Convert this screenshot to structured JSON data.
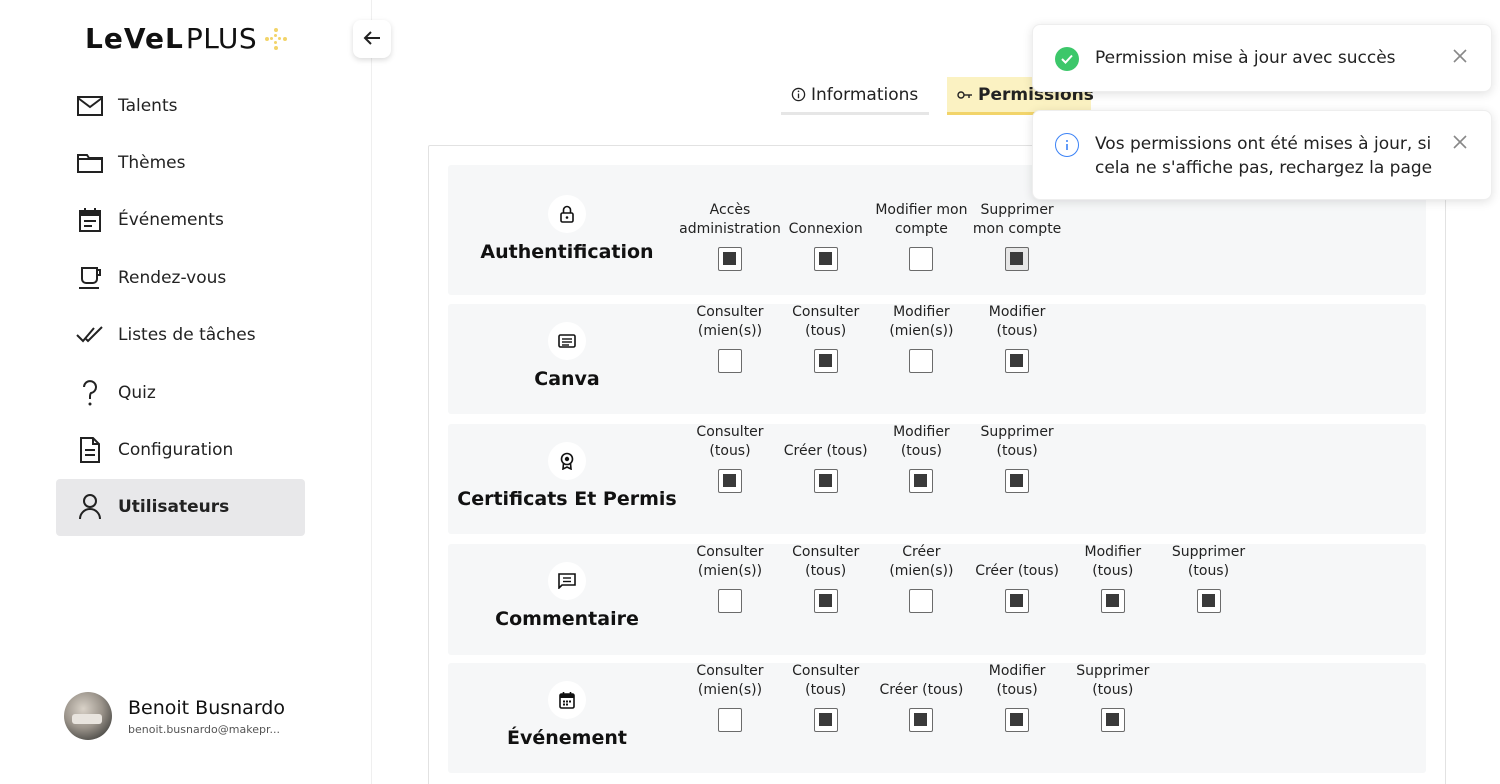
{
  "app": {
    "logo_level": "LeVeL",
    "logo_plus": "PLUS"
  },
  "sidebar": {
    "items": [
      {
        "label": "Talents",
        "icon": "mail-icon"
      },
      {
        "label": "Thèmes",
        "icon": "folder-icon"
      },
      {
        "label": "Événements",
        "icon": "calendar-icon"
      },
      {
        "label": "Rendez-vous",
        "icon": "cup-icon"
      },
      {
        "label": "Listes de tâches",
        "icon": "double-check-icon"
      },
      {
        "label": "Quiz",
        "icon": "question-icon"
      },
      {
        "label": "Configuration",
        "icon": "document-icon"
      },
      {
        "label": "Utilisateurs",
        "icon": "user-icon",
        "active": true
      }
    ],
    "profile": {
      "name": "Benoit Busnardo",
      "email": "benoit.busnardo@makepr..."
    }
  },
  "tabs": [
    {
      "label": "Informations",
      "icon": "info-icon"
    },
    {
      "label": "Permissions",
      "icon": "key-icon",
      "active": true
    }
  ],
  "permissions": [
    {
      "module": "Authentification",
      "icon": "lock-icon",
      "perms": [
        {
          "label": "Accès administration",
          "checked": true
        },
        {
          "label": "Connexion",
          "checked": true
        },
        {
          "label": "Modifier mon compte",
          "checked": false
        },
        {
          "label": "Supprimer mon compte",
          "checked": true
        }
      ]
    },
    {
      "module": "Canva",
      "icon": "canva-icon",
      "perms": [
        {
          "label": "Consulter (mien(s))",
          "checked": false
        },
        {
          "label": "Consulter (tous)",
          "checked": true
        },
        {
          "label": "Modifier (mien(s))",
          "checked": false
        },
        {
          "label": "Modifier (tous)",
          "checked": true
        }
      ]
    },
    {
      "module": "Certificats Et Permis",
      "icon": "award-icon",
      "perms": [
        {
          "label": "Consulter (tous)",
          "checked": true
        },
        {
          "label": "Créer (tous)",
          "checked": true
        },
        {
          "label": "Modifier (tous)",
          "checked": true
        },
        {
          "label": "Supprimer (tous)",
          "checked": true
        }
      ]
    },
    {
      "module": "Commentaire",
      "icon": "comment-icon",
      "perms": [
        {
          "label": "Consulter (mien(s))",
          "checked": false
        },
        {
          "label": "Consulter (tous)",
          "checked": true
        },
        {
          "label": "Créer (mien(s))",
          "checked": false
        },
        {
          "label": "Créer (tous)",
          "checked": true
        },
        {
          "label": "Modifier (tous)",
          "checked": true
        },
        {
          "label": "Supprimer (tous)",
          "checked": true
        }
      ]
    },
    {
      "module": "Événement",
      "icon": "calendar-small-icon",
      "perms": [
        {
          "label": "Consulter (mien(s))",
          "checked": false
        },
        {
          "label": "Consulter (tous)",
          "checked": true
        },
        {
          "label": "Créer (tous)",
          "checked": true
        },
        {
          "label": "Modifier (tous)",
          "checked": true
        },
        {
          "label": "Supprimer (tous)",
          "checked": true
        }
      ]
    }
  ],
  "toasts": [
    {
      "type": "success",
      "text": "Permission mise à jour avec succès",
      "color": "#3cc76a"
    },
    {
      "type": "info",
      "text": "Vos permissions ont été mises à jour, si cela ne s'affiche pas, rechargez la page",
      "color": "#3b82f6"
    }
  ]
}
